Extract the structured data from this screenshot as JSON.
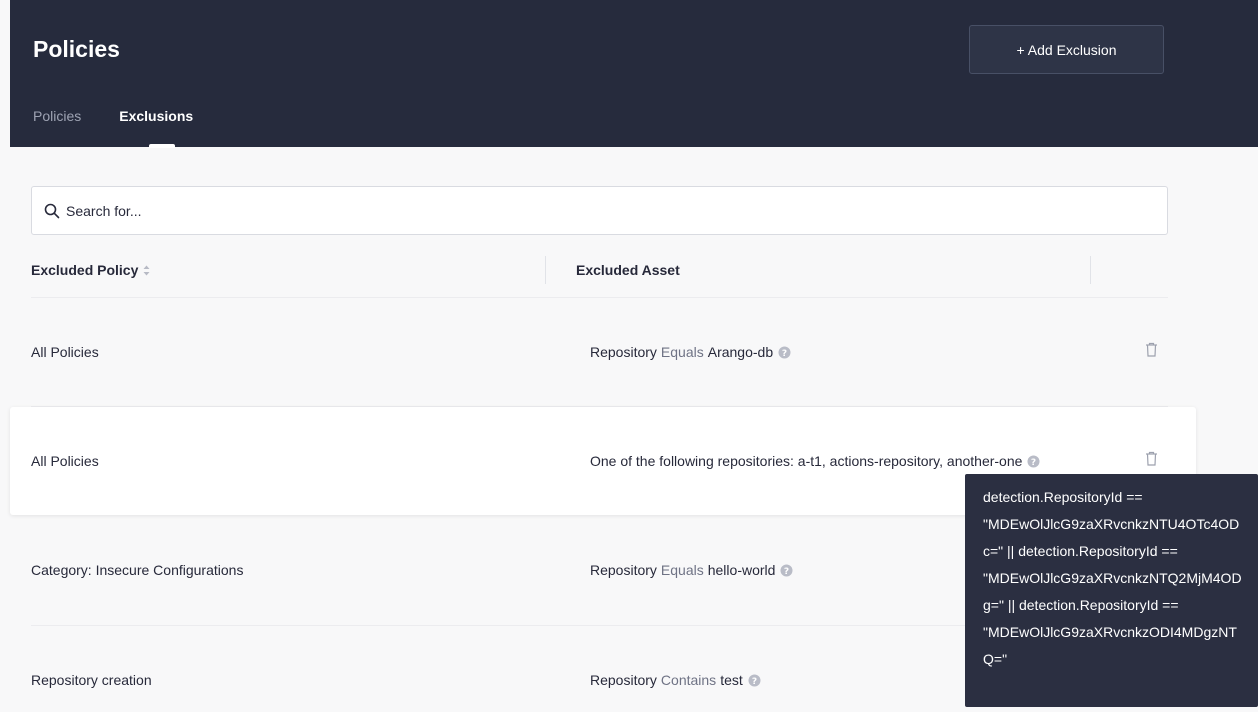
{
  "header": {
    "title": "Policies",
    "add_button_label": "+ Add Exclusion",
    "tabs": [
      {
        "label": "Policies",
        "active": false
      },
      {
        "label": "Exclusions",
        "active": true
      }
    ]
  },
  "search": {
    "placeholder": "Search for...",
    "value": ""
  },
  "table": {
    "columns": {
      "policy": "Excluded Policy",
      "asset": "Excluded Asset"
    },
    "rows": [
      {
        "policy": "All Policies",
        "asset_field": "Repository",
        "asset_operator": "Equals",
        "asset_value": "Arango-db"
      },
      {
        "policy": "All Policies",
        "asset_text": "One of the following repositories: a-t1, actions-repository, another-one"
      },
      {
        "policy": "Category: Insecure Configurations",
        "asset_field": "Repository",
        "asset_operator": "Equals",
        "asset_value": "hello-world"
      },
      {
        "policy": "Repository creation",
        "asset_field": "Repository",
        "asset_operator": "Contains",
        "asset_value": "test"
      }
    ]
  },
  "tooltip": {
    "text": "detection.RepositoryId == \"MDEwOlJlcG9zaXRvcnkzNTU4OTc4ODc=\" || detection.RepositoryId == \"MDEwOlJlcG9zaXRvcnkzNTQ2MjM4ODg=\" || detection.RepositoryId == \"MDEwOlJlcG9zaXRvcnkzODI4MDgzNTQ=\""
  },
  "colors": {
    "header_bg": "#262b3d",
    "tooltip_bg": "#2b2f41",
    "muted_text": "#6f7385"
  },
  "icons": {
    "search": "search-icon",
    "sort": "sort-icon",
    "info": "info-icon",
    "delete": "trash-icon"
  }
}
